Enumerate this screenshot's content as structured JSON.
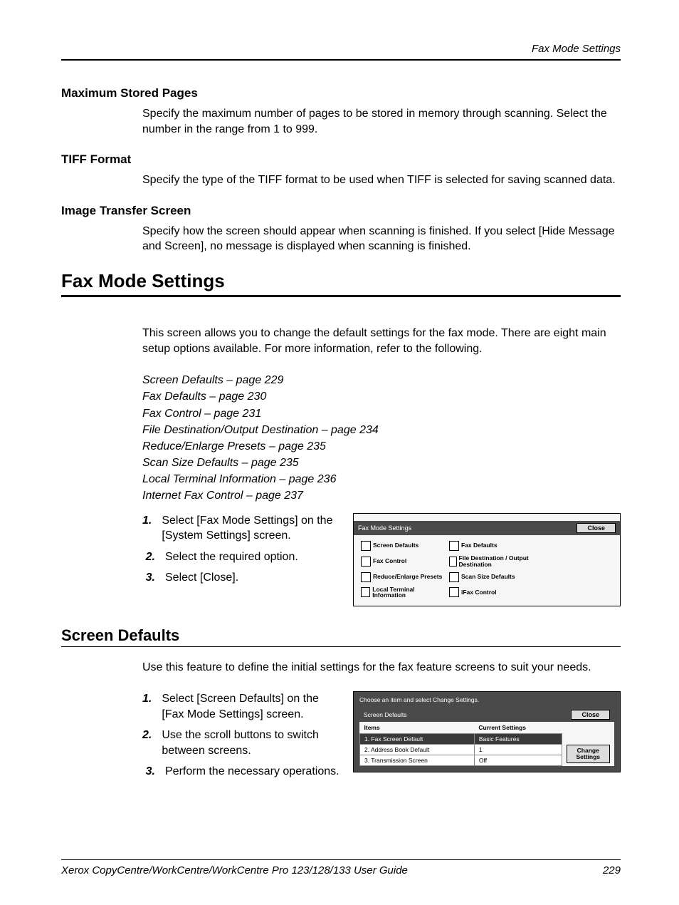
{
  "running_head": "Fax Mode Settings",
  "sections": {
    "max_stored": {
      "title": "Maximum Stored Pages",
      "body": "Specify the maximum number of pages to be stored in memory through scanning. Select the number in the range from 1 to 999."
    },
    "tiff": {
      "title": "TIFF Format",
      "body": "Specify the type of the TIFF format to be used when TIFF is selected for saving scanned data."
    },
    "image_transfer": {
      "title": "Image Transfer Screen",
      "body": "Specify how the screen should appear when scanning is finished. If you select [Hide Message and Screen], no message is displayed when scanning is finished."
    }
  },
  "fax_mode": {
    "title": "Fax Mode Settings",
    "intro": "This screen allows you to change the default settings for the fax mode. There are eight main setup options available. For more information, refer to the following.",
    "links": [
      "Screen Defaults – page 229",
      "Fax Defaults – page 230",
      "Fax Control – page 231",
      "File Destination/Output Destination – page 234",
      "Reduce/Enlarge Presets – page 235",
      "Scan Size Defaults – page 235",
      "Local Terminal Information – page 236",
      "Internet Fax Control – page 237"
    ],
    "steps": [
      "Select [Fax Mode Settings] on the [System Settings] screen.",
      "Select the required option.",
      "Select [Close]."
    ],
    "screenshot": {
      "bar_title": "Fax Mode Settings",
      "close": "Close",
      "buttons": [
        "Screen Defaults",
        "Fax Defaults",
        "Fax Control",
        "File Destination / Output Destination",
        "Reduce/Enlarge Presets",
        "Scan Size Defaults",
        "Local Terminal Information",
        "iFax Control"
      ]
    }
  },
  "screen_defaults": {
    "title": "Screen Defaults",
    "intro": "Use this feature to define the initial settings for the fax feature screens to suit your needs.",
    "steps": [
      "Select [Screen Defaults] on the [Fax Mode Settings] screen.",
      "Use the scroll buttons to switch between screens.",
      "Perform the necessary operations."
    ],
    "screenshot": {
      "top_text": "Choose an item and select Change Settings.",
      "bar_title": "Screen Defaults",
      "close": "Close",
      "col_items": "Items",
      "col_current": "Current Settings",
      "rows": [
        {
          "item": "1. Fax Screen Default",
          "value": "Basic Features"
        },
        {
          "item": "2. Address Book Default",
          "value": "1"
        },
        {
          "item": "3. Transmission Screen",
          "value": "Off"
        }
      ],
      "change": "Change Settings"
    }
  },
  "footer": {
    "left": "Xerox CopyCentre/WorkCentre/WorkCentre Pro 123/128/133 User Guide",
    "right": "229"
  }
}
